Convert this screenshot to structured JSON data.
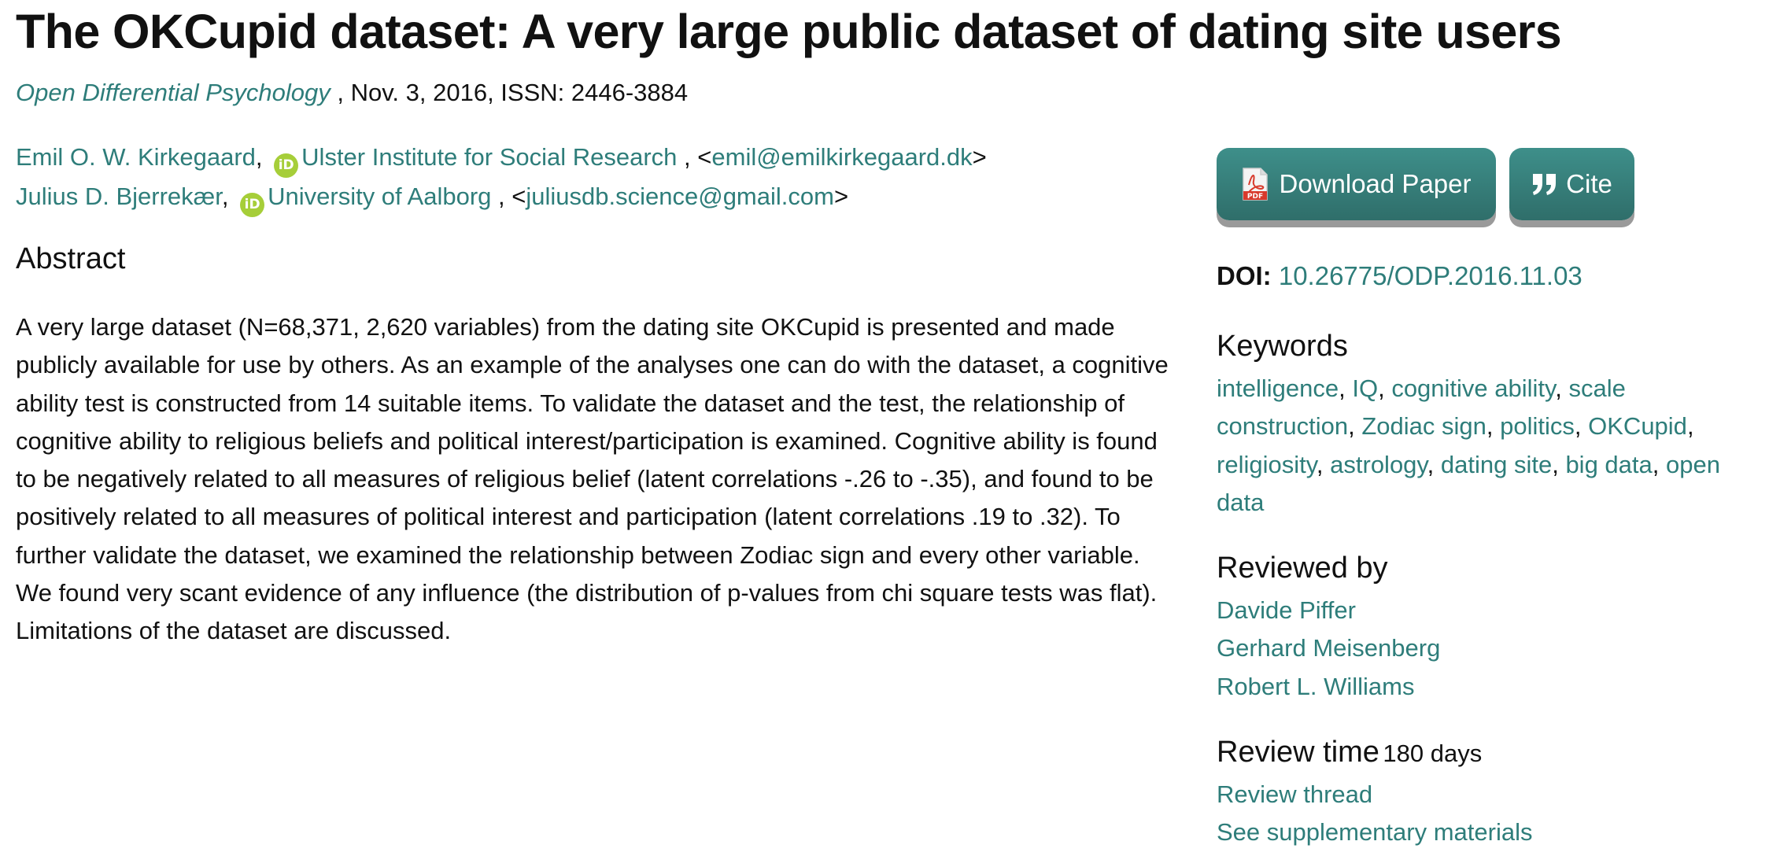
{
  "title": "The OKCupid dataset: A very large public dataset of dating site users",
  "journal": "Open Differential Psychology",
  "pub_info": " , Nov. 3, 2016, ISSN: 2446-3884",
  "authors": [
    {
      "name": "Emil O. W. Kirkegaard",
      "affiliation": "Ulster Institute for Social Research",
      "email": "emil@emilkirkegaard.dk"
    },
    {
      "name": "Julius D. Bjerrekær",
      "affiliation": "University of Aalborg",
      "email": "juliusdb.science@gmail.com"
    }
  ],
  "orcid_label": "iD",
  "abstract": {
    "heading": "Abstract",
    "text": "A very large dataset (N=68,371, 2,620 variables) from the dating site OKCupid is presented and made publicly available for use by others. As an example of the analyses one can do with the dataset, a cognitive ability test is constructed from 14 suitable items. To validate the dataset and the test, the relationship of cognitive ability to religious beliefs and political interest/participation is examined. Cognitive ability is found to be negatively related to all measures of religious belief (latent correlations -.26 to -.35), and found to be positively related to all measures of political interest and participation (latent correlations .19 to .32). To further validate the dataset, we examined the relationship between Zodiac sign and every other variable. We found very scant evidence of any influence (the distribution of p-values from chi square tests was flat). Limitations of the dataset are discussed."
  },
  "sidebar": {
    "download_label": "Download Paper",
    "pdf_icon_text": "PDF",
    "cite_label": "Cite",
    "doi_label": "DOI:",
    "doi_value": "10.26775/ODP.2016.11.03",
    "keywords_heading": "Keywords",
    "keywords": [
      "intelligence",
      "IQ",
      "cognitive ability",
      "scale construction",
      "Zodiac sign",
      "politics",
      "OKCupid",
      "religiosity",
      "astrology",
      "dating site",
      "big data",
      "open data"
    ],
    "reviewed_by_heading": "Reviewed by",
    "reviewers": [
      "Davide Piffer",
      "Gerhard Meisenberg",
      "Robert L. Williams"
    ],
    "review_time_heading": "Review time",
    "review_time_value": "180 days",
    "review_thread_label": "Review thread",
    "supplementary_label": "See supplementary materials"
  },
  "colors": {
    "link": "#2e7d7a",
    "button": "#357d79",
    "orcid": "#a6ce39",
    "pdf": "#d8392b"
  }
}
